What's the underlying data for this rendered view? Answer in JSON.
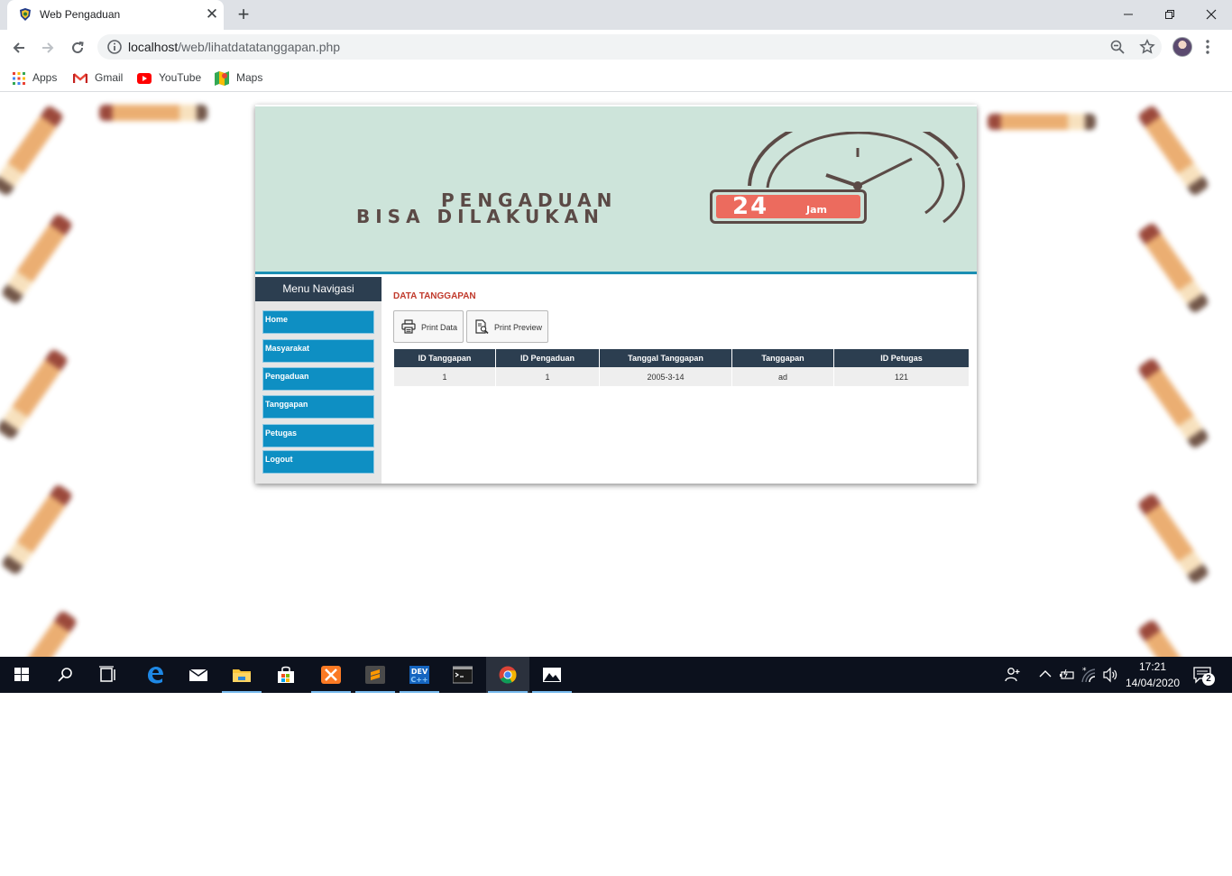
{
  "browser": {
    "tab_title": "Web Pengaduan",
    "tab_close": "✕",
    "new_tab": "+",
    "url_host": "localhost",
    "url_path": "/web/lihatdatatanggapan.php",
    "bookmarks": [
      "Apps",
      "Gmail",
      "YouTube",
      "Maps"
    ]
  },
  "banner": {
    "line1": "PENGADUAN",
    "line2": "BISA DILAKUKAN",
    "badge_number": "24",
    "badge_unit": "Jam"
  },
  "sidebar": {
    "title": "Menu Navigasi",
    "items": [
      "Home",
      "Masyarakat",
      "Pengaduan",
      "Tanggapan",
      "Petugas",
      "Logout"
    ]
  },
  "main": {
    "title": "DATA TANGGAPAN",
    "print_data_label": "Print Data",
    "print_preview_label": "Print Preview",
    "table": {
      "headers": [
        "ID Tanggapan",
        "ID Pengaduan",
        "Tanggal Tanggapan",
        "Tanggapan",
        "ID Petugas"
      ],
      "rows": [
        [
          "1",
          "1",
          "2005-3-14",
          "ad",
          "121"
        ]
      ]
    }
  },
  "taskbar": {
    "time": "17:21",
    "date": "14/04/2020",
    "notification_count": "2",
    "apps": [
      "start-icon",
      "search-icon",
      "task-view-icon",
      "edge-icon",
      "mail-icon",
      "file-explorer-icon",
      "store-icon",
      "xampp-icon",
      "sublime-text-icon",
      "devcpp-icon",
      "terminal-icon",
      "chrome-icon",
      "photos-icon"
    ]
  },
  "colors": {
    "banner_bg": "#cde4da",
    "nav_header": "#2c3e50",
    "menu_button": "#0e8fc3",
    "title_red": "#c0392b",
    "badge_red": "#ec6b5e"
  }
}
